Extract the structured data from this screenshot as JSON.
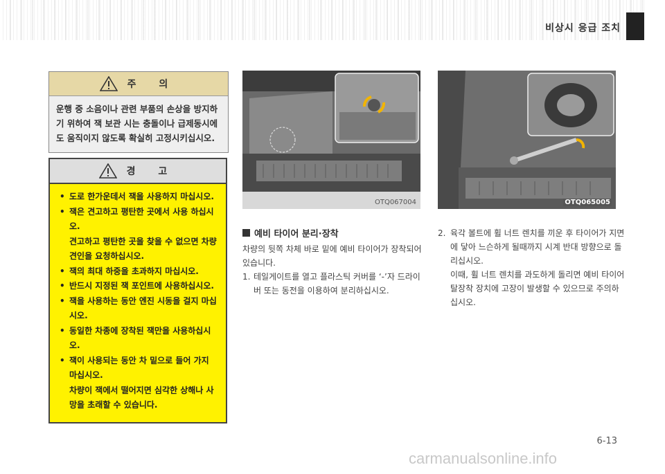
{
  "header": {
    "title": "비상시 응급 조치"
  },
  "caution": {
    "title": "주 의",
    "text": "운행 중 소음이나 관련 부품의 손상을 방지하기 위하여 잭 보관 시는 충돌이나 급제동시에도 움직이지 않도록 확실히 고정시키십시오."
  },
  "warning": {
    "title": "경 고",
    "items": [
      {
        "text": "도로 한가운데서 잭을 사용하지 마십시오.",
        "sub": ""
      },
      {
        "text": "잭은 견고하고 평탄한 곳에서 사용 하십시오.",
        "sub": "견고하고 평탄한 곳을 찾을 수 없으면 차량견인을 요청하십시오."
      },
      {
        "text": "잭의 최대 하중을 초과하지 마십시오.",
        "sub": ""
      },
      {
        "text": "반드시 지정된 잭 포인트에 사용하십시오.",
        "sub": ""
      },
      {
        "text": "잭을 사용하는 동안 엔진 시동을 걸지 마십시오.",
        "sub": ""
      },
      {
        "text": "동일한 차종에 장착된 잭만을 사용하십시오.",
        "sub": ""
      },
      {
        "text": "잭이 사용되는 동안 차 밑으로 들어 가지 마십시오.",
        "sub": "차량이 잭에서 떨어지면 심각한 상해나 사망을 초래할 수 있습니다."
      }
    ]
  },
  "figures": {
    "fig1_code": "OTQ067004",
    "fig2_code": "OTQ065005"
  },
  "section": {
    "title": "예비 타이어 분리·장착",
    "intro": "차량의 뒷쪽 차체 바로 밑에 예비 타이어가 장착되어 있습니다.",
    "step1_num": "1.",
    "step1": "테일게이트를 열고 플라스틱 커버를 ‘-’자 드라이버 또는 동전을 이용하여 분리하십시오.",
    "step2_num": "2.",
    "step2": "육각 볼트에 휠 너트 렌치를 끼운 후 타이어가 지면에 닿아 느슨하게 될때까지 시계 반대 방향으로 돌리십시오.",
    "step2_note": "이때, 휠 너트 렌치를 과도하게 돌리면 예비 타이어 탈장착 장치에 고장이 발생할 수 있으므로 주의하십시오."
  },
  "page_number": "6-13",
  "watermark": "carmanualsonline.info",
  "colors": {
    "warning_bg": "#fff200",
    "caution_head": "#e6d8a6"
  }
}
